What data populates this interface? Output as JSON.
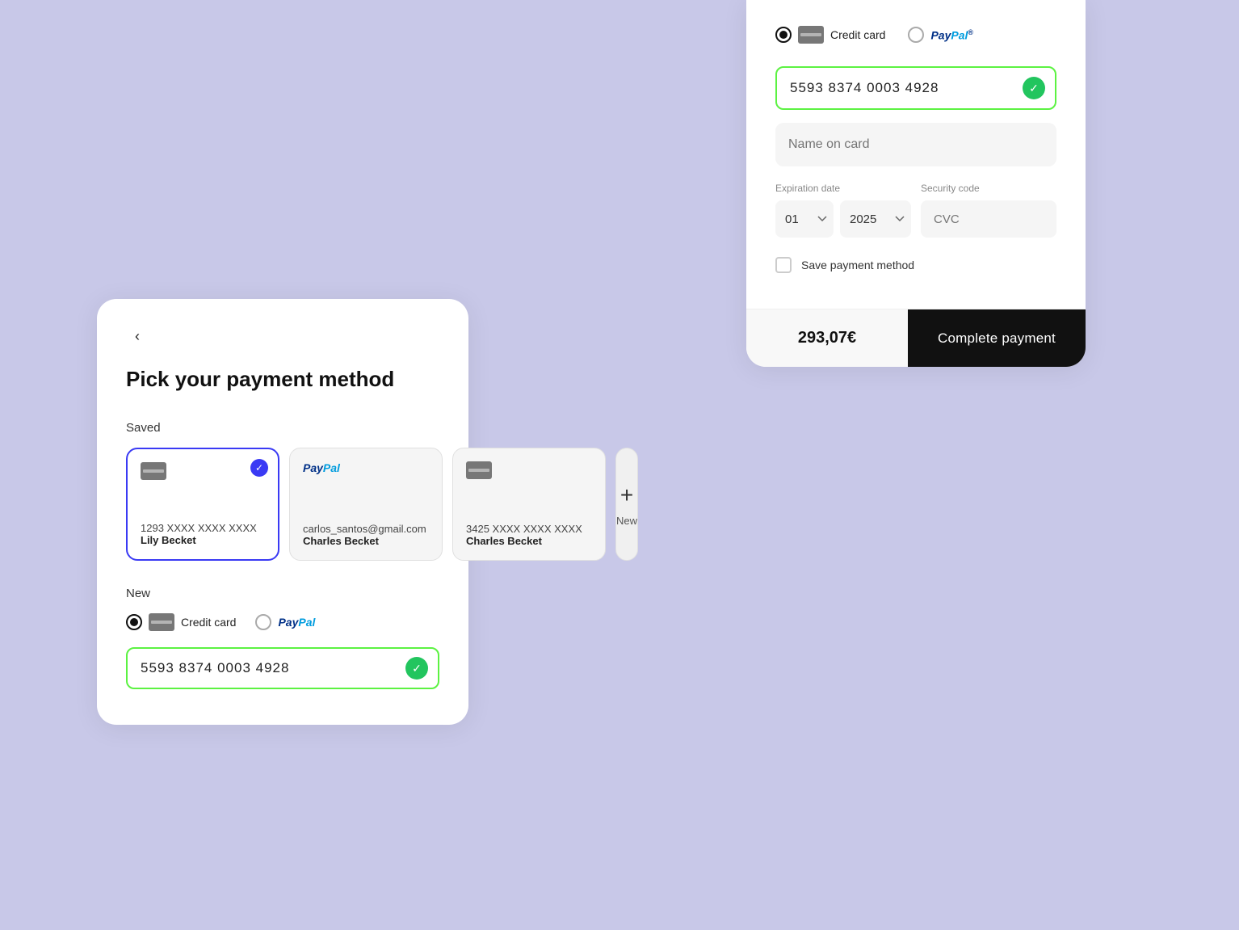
{
  "left_card": {
    "back_label": "‹",
    "title": "Pick your payment method",
    "saved_section_label": "Saved",
    "saved_cards": [
      {
        "type": "credit",
        "number": "1293 XXXX XXXX XXXX",
        "name": "Lily Becket",
        "selected": true
      },
      {
        "type": "paypal",
        "email": "carlos_santos@gmail.com",
        "name": "Charles Becket",
        "selected": false
      },
      {
        "type": "credit",
        "number": "3425 XXXX XXXX XXXX",
        "name": "Charles Becket",
        "selected": false
      }
    ],
    "new_card_label": "New",
    "new_section_label": "New",
    "payment_types": [
      {
        "label": "Credit card",
        "selected": true
      },
      {
        "label": "PayPal",
        "selected": false
      }
    ],
    "card_number_value": "5593 8374 0003 4928"
  },
  "right_card": {
    "payment_types": [
      {
        "label": "Credit card",
        "selected": true
      },
      {
        "label": "PayPal",
        "selected": false
      }
    ],
    "card_number_value": "5593 8374 0003 4928",
    "name_placeholder": "Name on card",
    "expiration_label": "Expiration date",
    "security_label": "Security code",
    "month_value": "01",
    "year_value": "2025",
    "cvc_placeholder": "CVC",
    "save_label": "Save payment method",
    "total_amount": "293,07€",
    "complete_btn_label": "Complete payment"
  },
  "icons": {
    "check": "✓",
    "plus": "+",
    "back": "‹",
    "chevron": "▾"
  }
}
